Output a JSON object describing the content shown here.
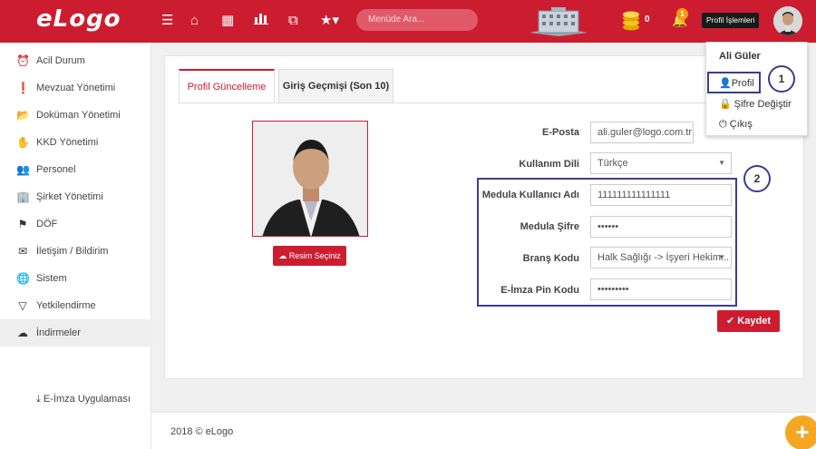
{
  "topbar": {
    "logo": "eLogo",
    "search_placeholder": "Menüde Ara...",
    "coin_count": "0",
    "notification_count": "1",
    "profile_button": "Profil İşlemleri",
    "accent": "#cc1d30"
  },
  "sidebar": {
    "items": [
      {
        "label": "Acil Durum",
        "icon": "alarm-clock-icon"
      },
      {
        "label": "Mevzuat Yönetimi",
        "icon": "exclamation-icon"
      },
      {
        "label": "Doküman Yönetimi",
        "icon": "folder-icon"
      },
      {
        "label": "KKD Yönetimi",
        "icon": "hand-icon"
      },
      {
        "label": "Personel",
        "icon": "users-icon"
      },
      {
        "label": "Şirket Yönetimi",
        "icon": "building-icon"
      },
      {
        "label": "DÖF",
        "icon": "flag-icon"
      },
      {
        "label": "İletişim / Bildirim",
        "icon": "envelope-icon"
      },
      {
        "label": "Sistem",
        "icon": "globe-icon"
      },
      {
        "label": "Yetkilendirme",
        "icon": "filter-icon"
      },
      {
        "label": "İndirmeler",
        "icon": "cloud-download-icon"
      }
    ],
    "sub_item": "E-İmza Uygulaması"
  },
  "tabs": [
    {
      "label": "Profil Güncelleme",
      "active": true
    },
    {
      "label": "Giriş Geçmişi (Son 10)",
      "active": false
    }
  ],
  "photo_button": "Resim Seçiniz",
  "form": {
    "email": {
      "label": "E-Posta",
      "value": "ali.guler@logo.com.tr"
    },
    "language": {
      "label": "Kullanım Dili",
      "value": "Türkçe"
    },
    "medula_user": {
      "label": "Medula Kullanıcı Adı",
      "value": "111111111111111"
    },
    "medula_password": {
      "label": "Medula Şifre",
      "value": "••••••"
    },
    "branch_code": {
      "label": "Branş Kodu",
      "value": "Halk Sağlığı -> İşyeri Hekim..."
    },
    "pin_code": {
      "label": "E-İmza Pin Kodu",
      "value": "•••••••••"
    },
    "save_label": "Kaydet"
  },
  "dropdown": {
    "user_name": "Ali Güler",
    "items": [
      "Profil",
      "Şifre Değiştir",
      "Çıkış"
    ]
  },
  "callouts": [
    "1",
    "2"
  ],
  "footer": "2018 © eLogo"
}
